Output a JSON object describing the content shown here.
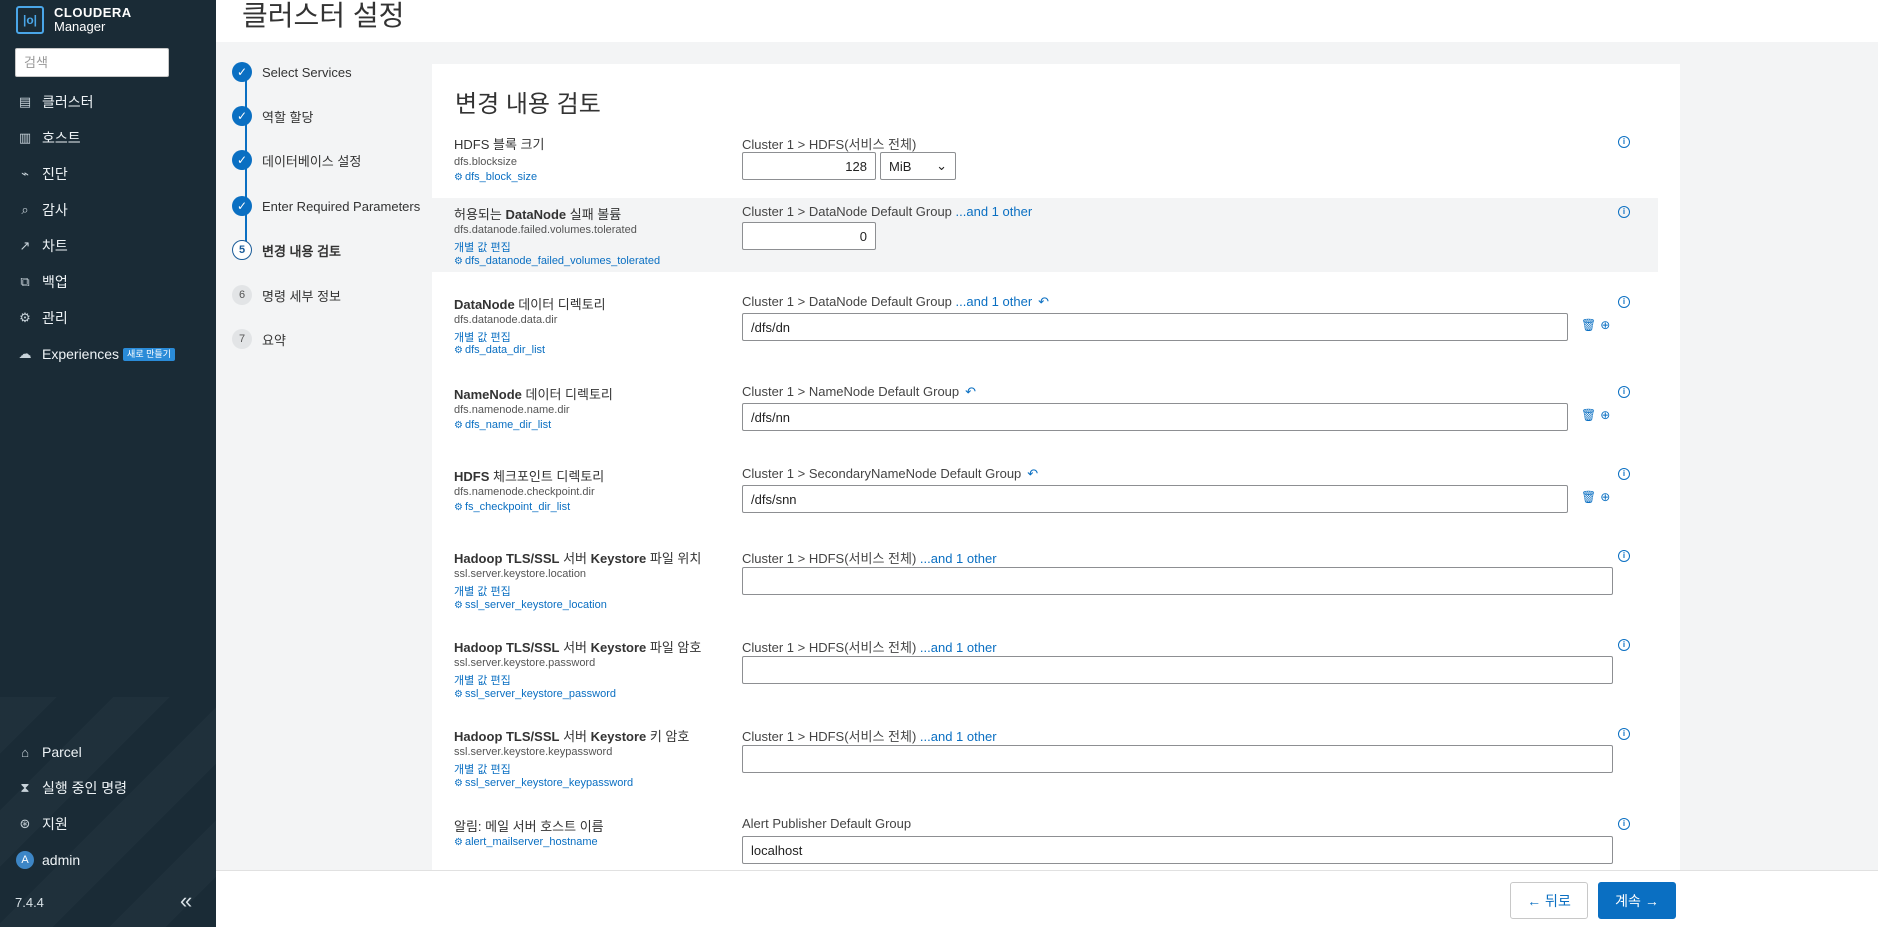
{
  "app": {
    "brand_line1": "CLOUDERA",
    "brand_line2": "Manager",
    "logo_glyph": "|o|",
    "version": "7.4.4"
  },
  "sidebar": {
    "search_placeholder": "검색",
    "items": [
      {
        "label": "클러스터",
        "icon": "cluster-icon"
      },
      {
        "label": "호스트",
        "icon": "hosts-icon"
      },
      {
        "label": "진단",
        "icon": "diagnostics-icon"
      },
      {
        "label": "감사",
        "icon": "audit-icon"
      },
      {
        "label": "차트",
        "icon": "chart-icon"
      },
      {
        "label": "백업",
        "icon": "backup-icon"
      },
      {
        "label": "관리",
        "icon": "gear-icon"
      },
      {
        "label": "Experiences",
        "icon": "cloud-icon",
        "badge": "새로 만들기"
      }
    ],
    "bottom_items": [
      {
        "label": "Parcel",
        "icon": "parcel-icon"
      },
      {
        "label": "실행 중인 명령",
        "icon": "hourglass-icon"
      },
      {
        "label": "지원",
        "icon": "support-icon"
      },
      {
        "label": "admin",
        "icon": "user-avatar",
        "avatar_letter": "A"
      }
    ]
  },
  "header": {
    "title": "클러스터 설정"
  },
  "steps": [
    {
      "label": "Select Services",
      "state": "done"
    },
    {
      "label": "역할 할당",
      "state": "done"
    },
    {
      "label": "데이터베이스 설정",
      "state": "done"
    },
    {
      "label": "Enter Required Parameters",
      "state": "done"
    },
    {
      "label": "변경 내용 검토",
      "state": "current",
      "num": "5"
    },
    {
      "label": "명령 세부 정보",
      "state": "todo",
      "num": "6"
    },
    {
      "label": "요약",
      "state": "todo",
      "num": "7"
    }
  ],
  "panel": {
    "title": "변경 내용 검토",
    "more_link": "...and 1 other",
    "edit_individual": "개별 값 편집",
    "rows": [
      {
        "label_pre": "HDFS 블록 크기",
        "key": "dfs.blocksize",
        "link": "dfs_block_size",
        "scope": "Cluster 1 > HDFS(서비스 전체)",
        "value": "128",
        "unit": "MiB"
      },
      {
        "label_pre": "허용되는 ",
        "label_bold": "DataNode",
        "label_post": " 실패 볼륨",
        "key": "dfs.datanode.failed.volumes.tolerated",
        "link": "dfs_datanode_failed_volumes_tolerated",
        "scope": "Cluster 1 > DataNode Default Group",
        "value": "0"
      },
      {
        "label_bold": "DataNode",
        "label_post": " 데이터 디렉토리",
        "key": "dfs.datanode.data.dir",
        "link": "dfs_data_dir_list",
        "scope": "Cluster 1 > DataNode Default Group",
        "value": "/dfs/dn"
      },
      {
        "label_bold": "NameNode",
        "label_post": " 데이터 디렉토리",
        "key": "dfs.namenode.name.dir",
        "link": "dfs_name_dir_list",
        "scope": "Cluster 1 > NameNode Default Group",
        "value": "/dfs/nn"
      },
      {
        "label_bold": "HDFS",
        "label_post": " 체크포인트 디렉토리",
        "key": "dfs.namenode.checkpoint.dir",
        "link": "fs_checkpoint_dir_list",
        "scope": "Cluster 1 > SecondaryNameNode Default Group",
        "value": "/dfs/snn"
      },
      {
        "label_bold": "Hadoop TLS/SSL",
        "label_mid": " 서버 ",
        "label_bold2": "Keystore",
        "label_post": " 파일 위치",
        "key": "ssl.server.keystore.location",
        "link": "ssl_server_keystore_location",
        "scope": "Cluster 1 > HDFS(서비스 전체)",
        "value": ""
      },
      {
        "label_bold": "Hadoop TLS/SSL",
        "label_mid": " 서버 ",
        "label_bold2": "Keystore",
        "label_post": " 파일 암호",
        "key": "ssl.server.keystore.password",
        "link": "ssl_server_keystore_password",
        "scope": "Cluster 1 > HDFS(서비스 전체)",
        "value": ""
      },
      {
        "label_bold": "Hadoop TLS/SSL",
        "label_mid": " 서버 ",
        "label_bold2": "Keystore",
        "label_post": " 키 암호",
        "key": "ssl.server.keystore.keypassword",
        "link": "ssl_server_keystore_keypassword",
        "scope": "Cluster 1 > HDFS(서비스 전체)",
        "value": ""
      },
      {
        "label_pre": "알림: 메일 서버 호스트 이름",
        "link": "alert_mailserver_hostname",
        "scope": "Alert Publisher Default Group",
        "value": "localhost"
      }
    ]
  },
  "footer": {
    "back_label": "← 뒤로",
    "next_label": "계속 →"
  },
  "colors": {
    "sidebar_bg": "#1a2b36",
    "accent": "#0a6fc2",
    "highlight_row": "#f3f4f5"
  }
}
